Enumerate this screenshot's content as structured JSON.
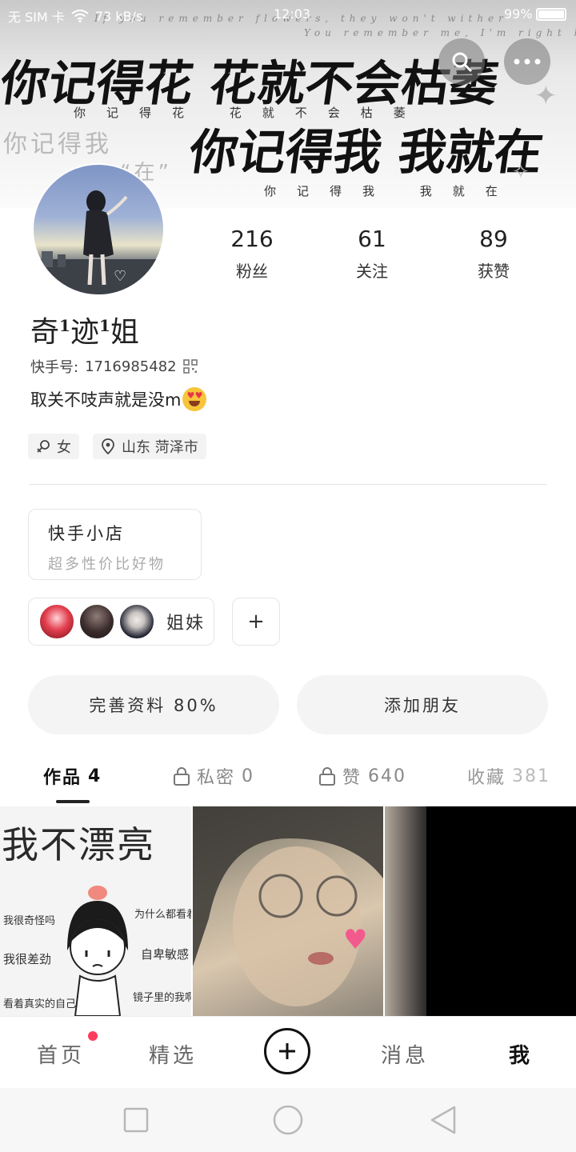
{
  "status_bar": {
    "carrier": "无 SIM 卡",
    "speed": "73 kB/s",
    "time": "12:03",
    "battery": "99%"
  },
  "banner": {
    "english_line_1": "If you remember flowers, they won't wither",
    "english_line_2": "You remember me, I'm right here",
    "big_line_1": "你记得花 花就不会枯萎",
    "small_line_1": "你记得花 花就不会枯萎",
    "ghost_line": "你记得我",
    "quote_word": "“在”",
    "big_line_2": "你记得我 我就在",
    "small_line_2": "你记得我 我就在"
  },
  "profile": {
    "nickname_parts": [
      "奇",
      "1",
      "迹",
      "1",
      "姐"
    ],
    "id_label": "快手号:",
    "id_value": "1716985482",
    "bio": "取关不吱声就是没m",
    "gender_tag": "女",
    "location_tag": "山东 菏泽市",
    "stats": [
      {
        "value": "216",
        "label": "粉丝"
      },
      {
        "value": "61",
        "label": "关注"
      },
      {
        "value": "89",
        "label": "获赞"
      }
    ]
  },
  "shop": {
    "title": "快手小店",
    "subtitle": "超多性价比好物"
  },
  "sisters": {
    "label": "姐妹",
    "add": "+"
  },
  "actions": {
    "complete_profile": "完善资料 80%",
    "add_friend": "添加朋友"
  },
  "tabs": [
    {
      "label": "作品",
      "count": "4"
    },
    {
      "label": "私密",
      "count": "0"
    },
    {
      "label": "赞",
      "count": "640"
    },
    {
      "label": "收藏",
      "count": "381"
    }
  ],
  "thumbnails": {
    "t1_title": "我不漂亮",
    "t1_lines": [
      "我很奇怪吗",
      "为什么都看着",
      "我很差劲",
      "自卑敏感",
      "看着真实的自己",
      "镜子里的我啊"
    ]
  },
  "bottom_nav": {
    "home": "首页",
    "featured": "精选",
    "messages": "消息",
    "me": "我"
  },
  "colors": {
    "accent_red": "#ff3b5c",
    "text_primary": "#222222",
    "text_muted": "#aaaaaa"
  }
}
